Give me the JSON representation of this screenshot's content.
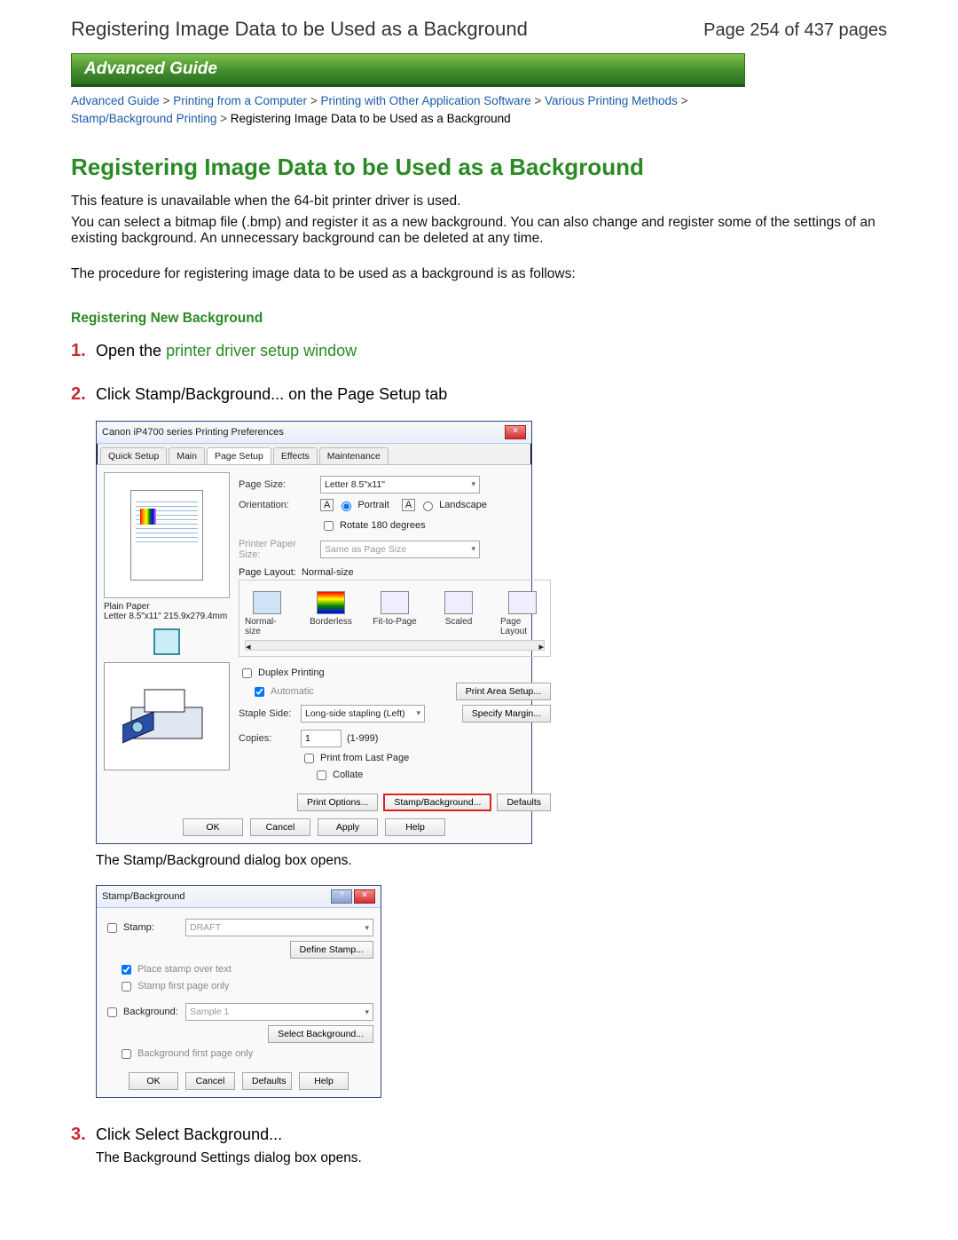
{
  "page": {
    "top_title": "Registering Image Data to be Used as a Background",
    "page_num": "Page 254 of 437 pages",
    "banner": "Advanced Guide"
  },
  "crumbs": {
    "c1": "Advanced Guide",
    "c2": "Printing from a Computer",
    "c3": "Printing with Other Application Software",
    "c4": "Various Printing Methods",
    "c5": "Stamp/Background Printing",
    "tail": "Registering Image Data to be Used as a Background",
    "sep": " > "
  },
  "content": {
    "h1": "Registering Image Data to be Used as a Background",
    "p1": "This feature is unavailable when the 64-bit printer driver is used.",
    "p2": "You can select a bitmap file (.bmp) and register it as a new background. You can also change and register some of the settings of an existing background. An unnecessary background can be deleted at any time.",
    "p3": "The procedure for registering image data to be used as a background is as follows:",
    "subhead": "Registering New Background",
    "steps": {
      "n1": "1.",
      "s1a": "Open the ",
      "s1b": "printer driver setup window",
      "n2": "2.",
      "s2": "Click Stamp/Background... on the Page Setup tab",
      "after2": "The Stamp/Background dialog box opens.",
      "n3": "3.",
      "s3": "Click Select Background...",
      "after3": "The Background Settings dialog box opens."
    }
  },
  "dlg1": {
    "title": "Canon iP4700 series Printing Preferences",
    "tabs": {
      "t1": "Quick Setup",
      "t2": "Main",
      "t3": "Page Setup",
      "t4": "Effects",
      "t5": "Maintenance"
    },
    "labels": {
      "page_size": "Page Size:",
      "page_size_val": "Letter 8.5\"x11\"",
      "orient": "Orientation:",
      "portrait": "Portrait",
      "landscape": "Landscape",
      "rotate": "Rotate 180 degrees",
      "printer_size": "Printer Paper Size:",
      "printer_size_val": "Same as Page Size",
      "layout_hdr": "Page Layout:",
      "layout_val": "Normal-size",
      "lo1": "Normal-size",
      "lo2": "Borderless",
      "lo3": "Fit-to-Page",
      "lo4": "Scaled",
      "lo5": "Page Layout",
      "duplex": "Duplex Printing",
      "auto": "Automatic",
      "print_area": "Print Area Setup...",
      "staple": "Staple Side:",
      "staple_val": "Long-side stapling (Left)",
      "margin": "Specify Margin...",
      "copies": "Copies:",
      "copies_val": "1",
      "copies_range": "(1-999)",
      "last": "Print from Last Page",
      "collate": "Collate",
      "print_opt": "Print Options...",
      "stamp_bg": "Stamp/Background...",
      "defaults": "Defaults",
      "ok": "OK",
      "cancel": "Cancel",
      "apply": "Apply",
      "help": "Help",
      "paper_caption1": "Plain Paper",
      "paper_caption2": "Letter 8.5\"x11\" 215.9x279.4mm"
    }
  },
  "dlg2": {
    "title": "Stamp/Background",
    "stamp": "Stamp:",
    "stamp_val": "DRAFT",
    "define": "Define Stamp...",
    "over": "Place stamp over text",
    "first": "Stamp first page only",
    "bg": "Background:",
    "bg_val": "Sample 1",
    "selbg": "Select Background...",
    "bgfirst": "Background first page only",
    "ok": "OK",
    "cancel": "Cancel",
    "defaults": "Defaults",
    "help": "Help"
  }
}
